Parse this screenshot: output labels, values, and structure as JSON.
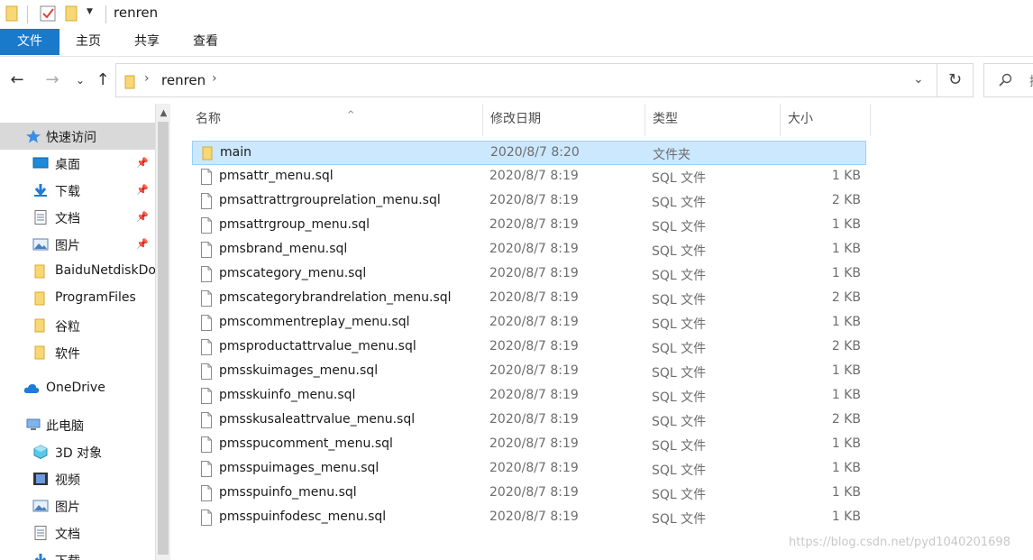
{
  "window": {
    "title": "renren"
  },
  "ribbon": {
    "tabs": [
      "文件",
      "主页",
      "共享",
      "查看"
    ]
  },
  "address": {
    "path_segment": "renren",
    "search_placeholder": "搜"
  },
  "sidebar": {
    "items": [
      {
        "label": "快速访问",
        "icon": "star-icon",
        "pinned": false
      },
      {
        "label": "桌面",
        "icon": "desktop-icon",
        "pinned": true
      },
      {
        "label": "下载",
        "icon": "download-icon",
        "pinned": true
      },
      {
        "label": "文档",
        "icon": "document-icon",
        "pinned": true
      },
      {
        "label": "图片",
        "icon": "picture-icon",
        "pinned": true
      },
      {
        "label": "BaiduNetdiskDo",
        "icon": "folder-icon",
        "pinned": false
      },
      {
        "label": "ProgramFiles",
        "icon": "folder-icon",
        "pinned": false
      },
      {
        "label": "谷粒",
        "icon": "folder-icon",
        "pinned": false
      },
      {
        "label": "软件",
        "icon": "folder-icon",
        "pinned": false
      },
      {
        "label": "OneDrive",
        "icon": "cloud-icon",
        "pinned": false
      },
      {
        "label": "此电脑",
        "icon": "computer-icon",
        "pinned": false
      },
      {
        "label": "3D 对象",
        "icon": "cube-icon",
        "pinned": false
      },
      {
        "label": "视频",
        "icon": "video-icon",
        "pinned": false
      },
      {
        "label": "图片",
        "icon": "picture-icon",
        "pinned": false
      },
      {
        "label": "文档",
        "icon": "document-icon",
        "pinned": false
      },
      {
        "label": "下载",
        "icon": "download-icon",
        "pinned": false
      }
    ]
  },
  "list": {
    "columns": [
      "名称",
      "修改日期",
      "类型",
      "大小"
    ],
    "rows": [
      {
        "name": "main",
        "date": "2020/8/7 8:20",
        "type": "文件夹",
        "size": "",
        "kind": "folder"
      },
      {
        "name": "pmsattr_menu.sql",
        "date": "2020/8/7 8:19",
        "type": "SQL 文件",
        "size": "1 KB",
        "kind": "file"
      },
      {
        "name": "pmsattrattrgrouprelation_menu.sql",
        "date": "2020/8/7 8:19",
        "type": "SQL 文件",
        "size": "2 KB",
        "kind": "file"
      },
      {
        "name": "pmsattrgroup_menu.sql",
        "date": "2020/8/7 8:19",
        "type": "SQL 文件",
        "size": "1 KB",
        "kind": "file"
      },
      {
        "name": "pmsbrand_menu.sql",
        "date": "2020/8/7 8:19",
        "type": "SQL 文件",
        "size": "1 KB",
        "kind": "file"
      },
      {
        "name": "pmscategory_menu.sql",
        "date": "2020/8/7 8:19",
        "type": "SQL 文件",
        "size": "1 KB",
        "kind": "file"
      },
      {
        "name": "pmscategorybrandrelation_menu.sql",
        "date": "2020/8/7 8:19",
        "type": "SQL 文件",
        "size": "2 KB",
        "kind": "file"
      },
      {
        "name": "pmscommentreplay_menu.sql",
        "date": "2020/8/7 8:19",
        "type": "SQL 文件",
        "size": "1 KB",
        "kind": "file"
      },
      {
        "name": "pmsproductattrvalue_menu.sql",
        "date": "2020/8/7 8:19",
        "type": "SQL 文件",
        "size": "2 KB",
        "kind": "file"
      },
      {
        "name": "pmsskuimages_menu.sql",
        "date": "2020/8/7 8:19",
        "type": "SQL 文件",
        "size": "1 KB",
        "kind": "file"
      },
      {
        "name": "pmsskuinfo_menu.sql",
        "date": "2020/8/7 8:19",
        "type": "SQL 文件",
        "size": "1 KB",
        "kind": "file"
      },
      {
        "name": "pmsskusaleattrvalue_menu.sql",
        "date": "2020/8/7 8:19",
        "type": "SQL 文件",
        "size": "2 KB",
        "kind": "file"
      },
      {
        "name": "pmsspucomment_menu.sql",
        "date": "2020/8/7 8:19",
        "type": "SQL 文件",
        "size": "1 KB",
        "kind": "file"
      },
      {
        "name": "pmsspuimages_menu.sql",
        "date": "2020/8/7 8:19",
        "type": "SQL 文件",
        "size": "1 KB",
        "kind": "file"
      },
      {
        "name": "pmsspuinfo_menu.sql",
        "date": "2020/8/7 8:19",
        "type": "SQL 文件",
        "size": "1 KB",
        "kind": "file"
      },
      {
        "name": "pmsspuinfodesc_menu.sql",
        "date": "2020/8/7 8:19",
        "type": "SQL 文件",
        "size": "1 KB",
        "kind": "file"
      }
    ]
  },
  "watermark": "https://blog.csdn.net/pyd1040201698",
  "colors": {
    "accent": "#1979ca",
    "selection": "#cce8ff",
    "folder": "#f8d775"
  }
}
